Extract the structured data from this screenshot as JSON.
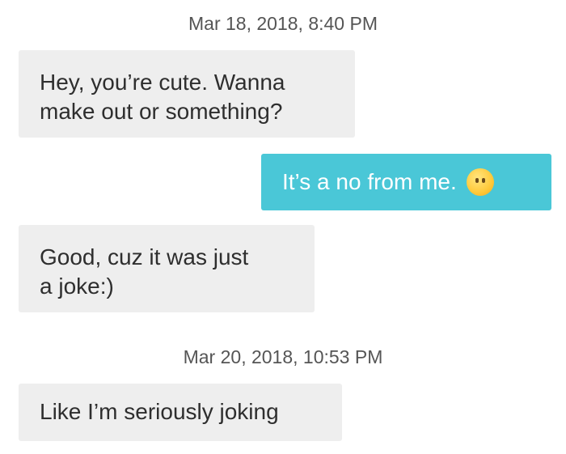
{
  "thread": {
    "timestamp_1": "Mar 18, 2018, 8:40 PM",
    "timestamp_2": "Mar 20, 2018, 10:53 PM"
  },
  "messages": [
    {
      "direction": "received",
      "lines": [
        "Hey, you’re cute. Wanna",
        "make out or something?"
      ]
    },
    {
      "direction": "sent",
      "text": "It’s a no from me.",
      "emoji": "face-without-mouth-emoji"
    },
    {
      "direction": "received",
      "lines": [
        "Good, cuz it was just",
        "a joke:)"
      ]
    },
    {
      "direction": "received",
      "lines": [
        "Like I’m seriously joking"
      ]
    }
  ],
  "colors": {
    "sent_bubble": "#4ac7d7",
    "received_bubble": "#eeeeee",
    "timestamp_text": "#555555"
  }
}
